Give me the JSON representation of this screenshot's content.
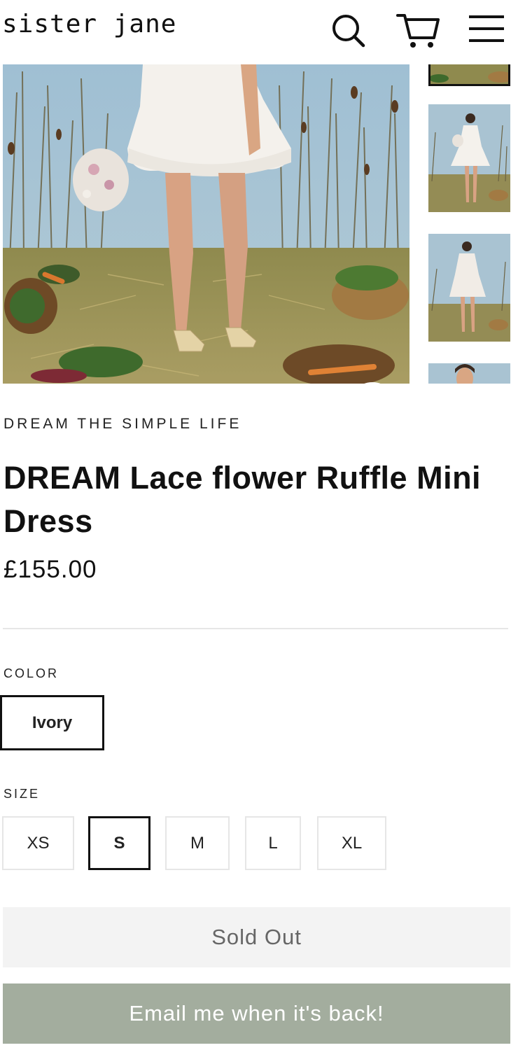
{
  "header": {
    "logo": "sister jane",
    "icons": [
      "search-icon",
      "cart-icon",
      "menu-icon"
    ]
  },
  "gallery": {
    "zoom_icon": "zoom-icon"
  },
  "product": {
    "vendor": "DREAM THE SIMPLE LIFE",
    "title_bold": "DREAM",
    "title_rest": " Lace flower Ruffle Mini Dress",
    "price": "£155.00"
  },
  "options": {
    "color_label": "COLOR",
    "color_value": "Ivory",
    "size_label": "SIZE",
    "sizes": [
      "XS",
      "S",
      "M",
      "L",
      "XL"
    ],
    "selected_size": "S"
  },
  "buttons": {
    "sold_out": "Sold Out",
    "notify": "Email me when it's back!"
  },
  "colors": {
    "notify_button": "#a3ad9e",
    "sold_out_button": "#f3f3f3",
    "text": "#111111"
  }
}
